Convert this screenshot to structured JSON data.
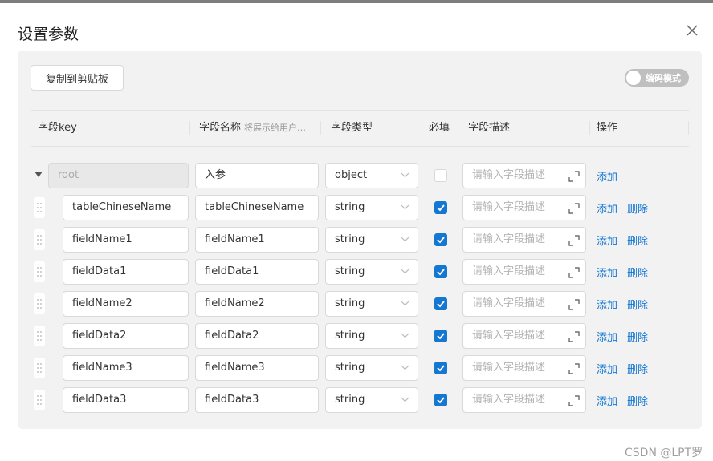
{
  "dialog": {
    "title": "设置参数",
    "copy_button": "复制到剪贴板",
    "toggle_label": "编码模式"
  },
  "columns": {
    "key": "字段key",
    "name": "字段名称",
    "name_hint": "将展示给用户…",
    "type": "字段类型",
    "required": "必填",
    "desc": "字段描述",
    "ops": "操作"
  },
  "root_row": {
    "key_placeholder": "root",
    "name": "入参",
    "type": "object",
    "required": false,
    "desc_placeholder": "请输入字段描述",
    "add": "添加"
  },
  "rows": [
    {
      "key": "tableChineseName",
      "name": "tableChineseName",
      "type": "string",
      "required": true,
      "desc_placeholder": "请输入字段描述",
      "add": "添加",
      "delete": "删除"
    },
    {
      "key": "fieldName1",
      "name": "fieldName1",
      "type": "string",
      "required": true,
      "desc_placeholder": "请输入字段描述",
      "add": "添加",
      "delete": "删除"
    },
    {
      "key": "fieldData1",
      "name": "fieldData1",
      "type": "string",
      "required": true,
      "desc_placeholder": "请输入字段描述",
      "add": "添加",
      "delete": "删除"
    },
    {
      "key": "fieldName2",
      "name": "fieldName2",
      "type": "string",
      "required": true,
      "desc_placeholder": "请输入字段描述",
      "add": "添加",
      "delete": "删除"
    },
    {
      "key": "fieldData2",
      "name": "fieldData2",
      "type": "string",
      "required": true,
      "desc_placeholder": "请输入字段描述",
      "add": "添加",
      "delete": "删除"
    },
    {
      "key": "fieldName3",
      "name": "fieldName3",
      "type": "string",
      "required": true,
      "desc_placeholder": "请输入字段描述",
      "add": "添加",
      "delete": "删除"
    },
    {
      "key": "fieldData3",
      "name": "fieldData3",
      "type": "string",
      "required": true,
      "desc_placeholder": "请输入字段描述",
      "add": "添加",
      "delete": "删除"
    }
  ],
  "watermark": "CSDN @LPT罗",
  "colors": {
    "accent": "#1677d2",
    "panel": "#f2f2f2",
    "toggle_off": "#bfbfbf"
  }
}
